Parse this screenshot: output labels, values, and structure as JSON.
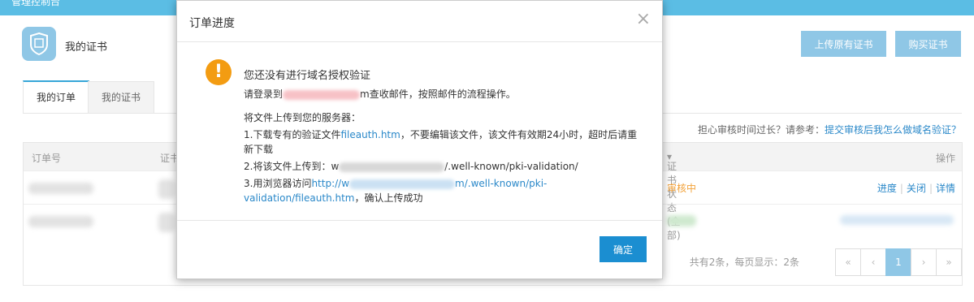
{
  "topbar": {
    "text": "管理控制台"
  },
  "page": {
    "title": "我的证书",
    "upload_button": "上传原有证书",
    "buy_button": "购买证书",
    "tabs": [
      {
        "label": "我的订单"
      },
      {
        "label": "我的证书"
      }
    ],
    "help_prefix": "担心审核时间过长？请参考：",
    "help_link": "提交审核后我怎么做域名验证？",
    "table": {
      "headers": [
        "订单号",
        "证书",
        "证书状态(全部)",
        "操作"
      ],
      "row1": {
        "status": "审核中",
        "op_progress": "进度",
        "op_close": "关闭",
        "op_detail": "详情"
      }
    },
    "pagination": {
      "info": "共有2条，每页显示：2条",
      "first": "«",
      "prev": "‹",
      "current": "1",
      "next": "›",
      "last": "»"
    }
  },
  "modal": {
    "title": "订单进度",
    "close_icon": "×",
    "warning_icon": "!",
    "heading": "您还没有进行域名授权验证",
    "line1_prefix": "请登录到",
    "line1_suffix": "m查收邮件，按照邮件的流程操作。",
    "line2": "将文件上传到您的服务器：",
    "step1_prefix": "1.下载专有的验证文件",
    "step1_link": "fileauth.htm",
    "step1_suffix": "，不要编辑该文件，该文件有效期24小时，超时后请重新下载",
    "step2_prefix": "2.将该文件上传到：w",
    "step2_suffix": "/.well-known/pki-validation/",
    "step3_prefix": "3.用浏览器访问",
    "step3_link_start": "http://w",
    "step3_link_end": "m/.well-known/pki-validation/fileauth.htm",
    "step3_suffix": "，确认上传成功",
    "ok_button": "确定"
  }
}
